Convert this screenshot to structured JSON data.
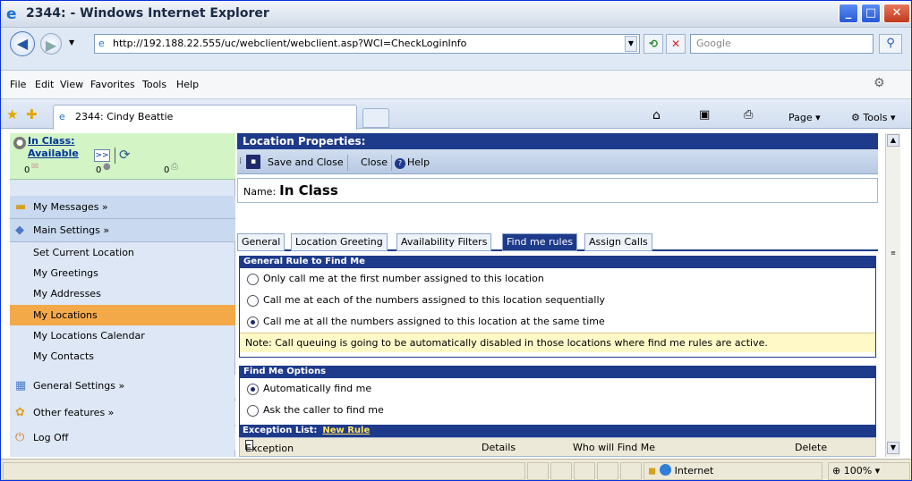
{
  "window": {
    "title": "2344: - Windows Internet Explorer"
  },
  "address": {
    "url": "http://192.188.22.555/uc/webclient/webclient.asp?WCI=CheckLoginInfo",
    "search_placeholder": "Google"
  },
  "menu": [
    "File",
    "Edit",
    "View",
    "Favorites",
    "Tools",
    "Help"
  ],
  "browser_tab": {
    "label": "2344: Cindy Beattie"
  },
  "command_bar": {
    "page": "Page",
    "tools": "Tools"
  },
  "sidebar": {
    "status_line1": "In Class:",
    "status_line2": "Available",
    "expand_label": ">>",
    "counts": [
      "0",
      "0",
      "0"
    ],
    "my_messages": "My Messages »",
    "main_settings": "Main Settings »",
    "items": [
      "Set Current Location",
      "My Greetings",
      "My Addresses",
      "My Locations",
      "My Locations Calendar",
      "My Contacts"
    ],
    "general_settings": "General Settings »",
    "other_features": "Other features »",
    "log_off": "Log Off"
  },
  "panel": {
    "title": "Location Properties:",
    "save_close": "Save and Close",
    "close": "Close",
    "help": "Help",
    "name_label": "Name:",
    "name_value": "In Class",
    "tabs": [
      "General",
      "Location Greeting",
      "Availability Filters",
      "Find me rules",
      "Assign Calls"
    ],
    "rule_head": "General Rule to Find Me",
    "rules": [
      "Only call me at the first number assigned to this location",
      "Call me at each of the numbers assigned to this location sequentially",
      "Call me at all the numbers assigned to this location at the same time"
    ],
    "note": "Note: Call queuing is going to be automatically disabled in those locations where find me rules are active.",
    "options_head": "Find Me Options",
    "options": [
      "Automatically find me",
      "Ask the caller to find me"
    ],
    "exception_head": "Exception List:",
    "new_rule": "New Rule",
    "ex_cols": [
      "Exception Rules",
      "Details",
      "Who will Find Me",
      "Delete"
    ]
  },
  "statusbar": {
    "zone": "Internet",
    "zoom": "100%"
  },
  "colors": {
    "accent": "#1e3a8a",
    "active_item": "#f4a948",
    "status_bg": "#d3f5c6"
  }
}
